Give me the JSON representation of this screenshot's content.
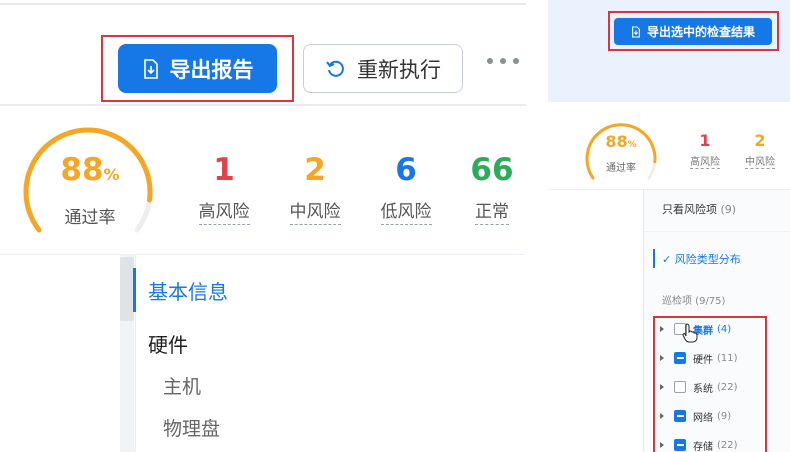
{
  "left_panel": {
    "toolbar": {
      "export_label": "导出报告",
      "rerun_label": "重新执行",
      "more_icon": "more-horizontal-icon"
    },
    "summary": {
      "pass_rate": {
        "value": "88",
        "unit": "%",
        "label": "通过率",
        "fraction": 0.88
      },
      "stats": [
        {
          "value": "1",
          "label": "高风险",
          "color": "#e0434b"
        },
        {
          "value": "2",
          "label": "中风险",
          "color": "#f5a623"
        },
        {
          "value": "6",
          "label": "低风险",
          "color": "#1677e6"
        },
        {
          "value": "66",
          "label": "正常",
          "color": "#2eaa5b"
        }
      ]
    },
    "nav": {
      "basic_info": "基本信息",
      "hardware": "硬件",
      "host": "主机",
      "physical_disk": "物理盘"
    }
  },
  "right_panel": {
    "export_selected_label": "导出选中的检查结果",
    "summary": {
      "pass_rate": {
        "value": "88",
        "unit": "%",
        "label": "通过率"
      },
      "stats": [
        {
          "value": "1",
          "label": "高风险",
          "color": "#e0434b"
        },
        {
          "value": "2",
          "label": "中风险",
          "color": "#f5a623"
        }
      ]
    },
    "filters": {
      "only_risk_label": "只看风险项",
      "only_risk_count": "(9)",
      "risk_type_label": "风险类型分布",
      "patrol_label": "巡检项 (9/75)"
    },
    "tree": [
      {
        "name": "集群",
        "count": "(4)",
        "state": "unchecked",
        "highlighted": true
      },
      {
        "name": "硬件",
        "count": "(11)",
        "state": "partial",
        "highlighted": false
      },
      {
        "name": "系统",
        "count": "(22)",
        "state": "unchecked",
        "highlighted": false
      },
      {
        "name": "网络",
        "count": "(9)",
        "state": "partial",
        "highlighted": false
      },
      {
        "name": "存储",
        "count": "(22)",
        "state": "partial",
        "highlighted": false
      }
    ]
  },
  "colors": {
    "accent": "#1677e6",
    "highlight_box": "#d9363e",
    "gauge": "#f5a623"
  }
}
